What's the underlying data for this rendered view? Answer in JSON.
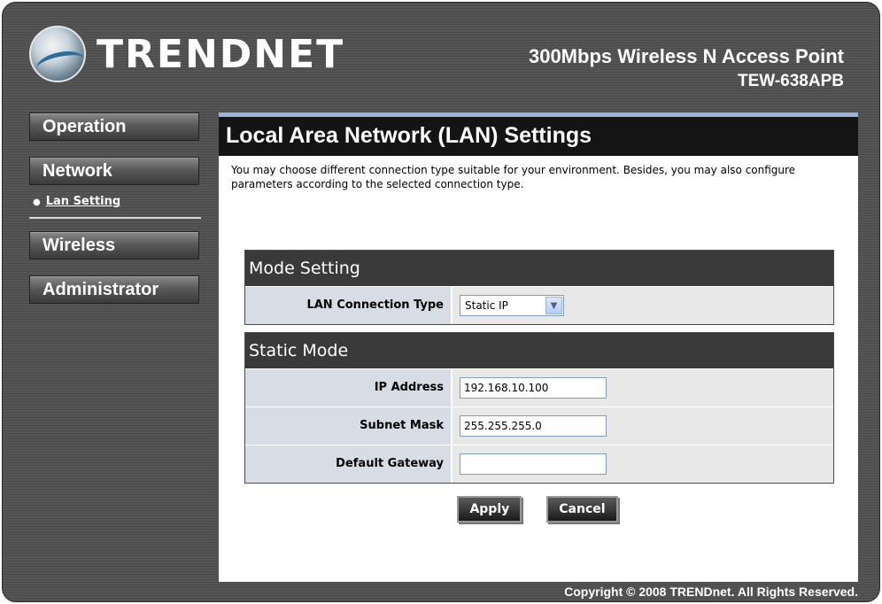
{
  "brand": {
    "name": "TRENDNET"
  },
  "product": {
    "title": "300Mbps Wireless N Access Point",
    "model": "TEW-638APB"
  },
  "nav": {
    "operation": "Operation",
    "network": "Network",
    "lan_setting": "Lan Setting",
    "wireless": "Wireless",
    "administrator": "Administrator"
  },
  "page": {
    "title": "Local Area Network (LAN) Settings",
    "intro": "You may choose different connection type suitable for your environment. Besides, you may also configure parameters according to the selected connection type."
  },
  "mode_setting": {
    "heading": "Mode Setting",
    "lan_connection_type_label": "LAN Connection Type",
    "lan_connection_type_value": "Static IP"
  },
  "static_mode": {
    "heading": "Static Mode",
    "ip_label": "IP Address",
    "ip_value": "192.168.10.100",
    "subnet_label": "Subnet Mask",
    "subnet_value": "255.255.255.0",
    "gateway_label": "Default Gateway",
    "gateway_value": ""
  },
  "actions": {
    "apply": "Apply",
    "cancel": "Cancel"
  },
  "footer": {
    "copyright": "Copyright © 2008 TRENDnet. All Rights Reserved."
  },
  "colors": {
    "title_bar": "#141414",
    "accent_top": "#9bb4d8",
    "row_label_bg": "#d8dce4"
  }
}
